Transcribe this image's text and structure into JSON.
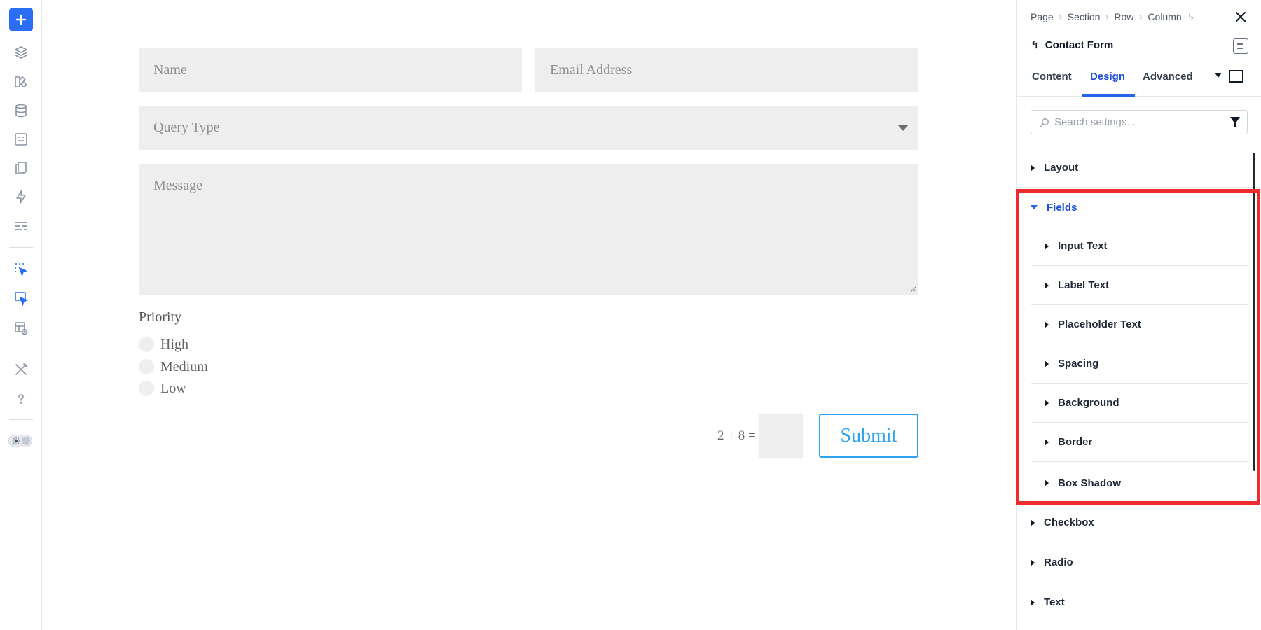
{
  "left_toolbar": {
    "items": [
      {
        "icon": "plus-icon"
      },
      {
        "icon": "layers-icon"
      },
      {
        "icon": "paint-palette-icon"
      },
      {
        "icon": "database-icon"
      },
      {
        "icon": "content-module-icon"
      },
      {
        "icon": "pages-icon"
      },
      {
        "icon": "lightning-icon"
      },
      {
        "icon": "form-layout-icon"
      },
      {
        "icon": "select-pointer-icon"
      },
      {
        "icon": "select-pointer-active-icon"
      },
      {
        "icon": "layout-preview-icon"
      },
      {
        "icon": "tools-icon"
      },
      {
        "icon": "help-icon"
      },
      {
        "icon": "theme-toggle-icon"
      }
    ],
    "accent_color": "#2c6df5"
  },
  "form": {
    "name_placeholder": "Name",
    "email_placeholder": "Email Address",
    "query_type_placeholder": "Query Type",
    "message_placeholder": "Message",
    "priority_label": "Priority",
    "priority_options": [
      "High",
      "Medium",
      "Low"
    ],
    "captcha_question": "2 + 8 =",
    "submit_label": "Submit",
    "submit_color": "#2ea3f2"
  },
  "panel": {
    "breadcrumbs": [
      "Page",
      "Section",
      "Row",
      "Column"
    ],
    "breadcrumb_goto_glyph": "↳",
    "module_title": "Contact Form",
    "back_glyph": "↰",
    "tabs": [
      "Content",
      "Design",
      "Advanced"
    ],
    "active_tab": "Design",
    "search_placeholder": "Search settings...",
    "groups": {
      "layout": "Layout",
      "fields": "Fields",
      "checkbox": "Checkbox",
      "radio": "Radio",
      "text": "Text"
    },
    "fields_subgroups": [
      "Input Text",
      "Label Text",
      "Placeholder Text",
      "Spacing",
      "Background",
      "Border",
      "Box Shadow"
    ],
    "highlight_color": "#ef2b2d",
    "active_color": "#2563eb"
  }
}
